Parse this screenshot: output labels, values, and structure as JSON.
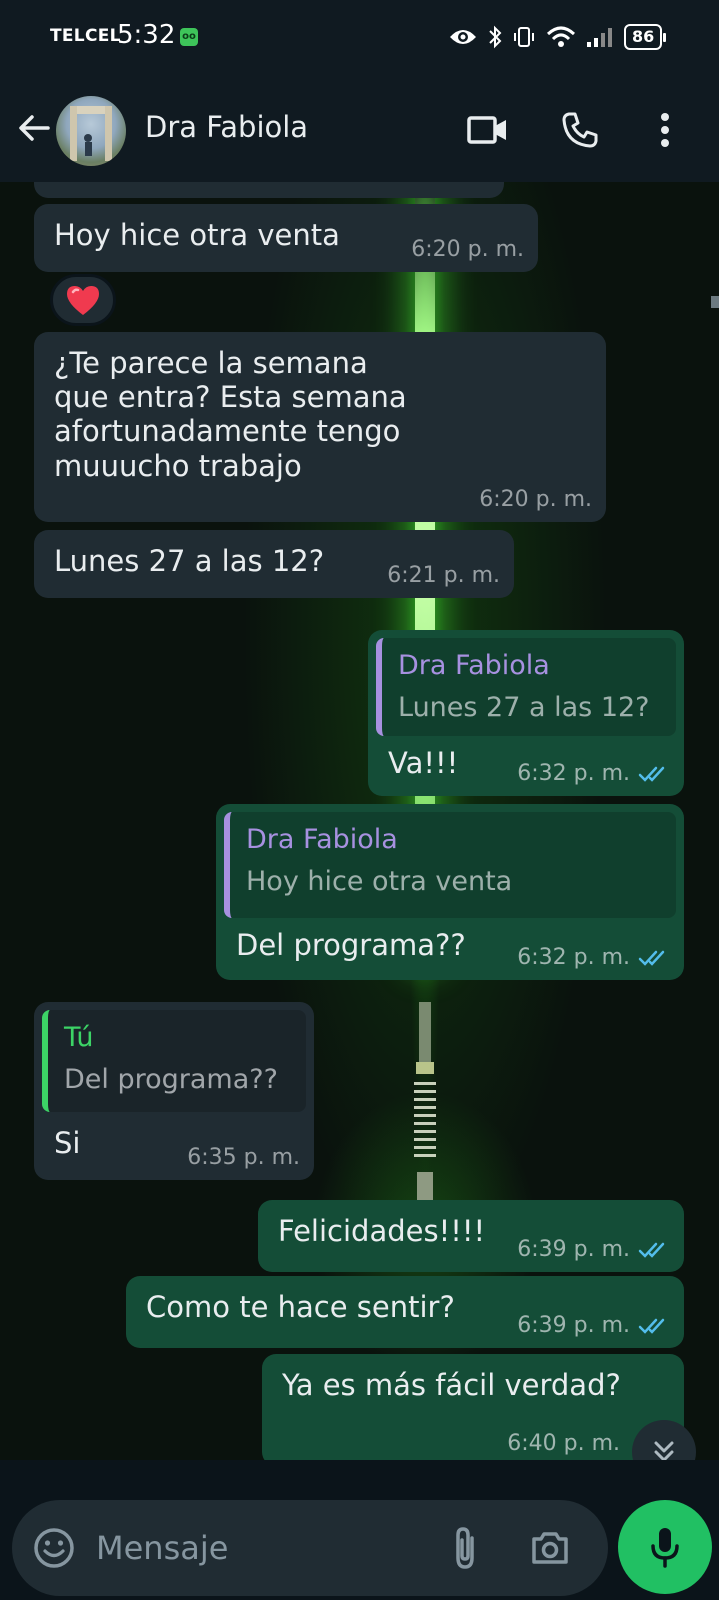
{
  "status_bar": {
    "carrier": "TELCEL",
    "time": "5:32",
    "data_badge": "oo",
    "battery": "86"
  },
  "header": {
    "contact_name": "Dra Fabiola",
    "icons": [
      "back-arrow-icon",
      "video-call-icon",
      "voice-call-icon",
      "more-options-icon"
    ]
  },
  "messages": [
    {
      "direction": "in",
      "text": "Hoy hice otra venta",
      "time": "6:20 p. m.",
      "reaction": "heart"
    },
    {
      "direction": "in",
      "lines": [
        "¿Te parece la semana",
        "que entra? Esta semana",
        "afortunadamente tengo",
        "muuucho trabajo"
      ],
      "time": "6:20 p. m."
    },
    {
      "direction": "in",
      "text": "Lunes 27 a las 12?",
      "time": "6:21 p. m."
    },
    {
      "direction": "out",
      "quote_author": "Dra Fabiola",
      "quote_text": "Lunes 27 a las 12?",
      "text": "Va!!!",
      "time": "6:32 p. m.",
      "status": "read"
    },
    {
      "direction": "out",
      "quote_author": "Dra Fabiola",
      "quote_text": "Hoy hice otra venta",
      "text": "Del programa??",
      "time": "6:32 p. m.",
      "status": "read"
    },
    {
      "direction": "in",
      "quote_author": "Tú",
      "quote_text": "Del programa??",
      "text": "Si",
      "time": "6:35 p. m."
    },
    {
      "direction": "out",
      "text": "Felicidades!!!!",
      "time": "6:39 p. m.",
      "status": "read"
    },
    {
      "direction": "out",
      "text": "Como te hace sentir?",
      "time": "6:39 p. m.",
      "status": "read"
    },
    {
      "direction": "out",
      "text": "Ya es más fácil verdad?",
      "time": "6:40 p. m.",
      "status": "read"
    }
  ],
  "composer": {
    "placeholder": "Mensaje"
  },
  "colors": {
    "incoming_bubble": "#202c33",
    "outgoing_bubble": "#144d37",
    "read_ticks": "#53bdeb",
    "mic_button": "#21c063",
    "quote_bar_contact": "#a791e0",
    "quote_bar_self": "#3cd366"
  }
}
